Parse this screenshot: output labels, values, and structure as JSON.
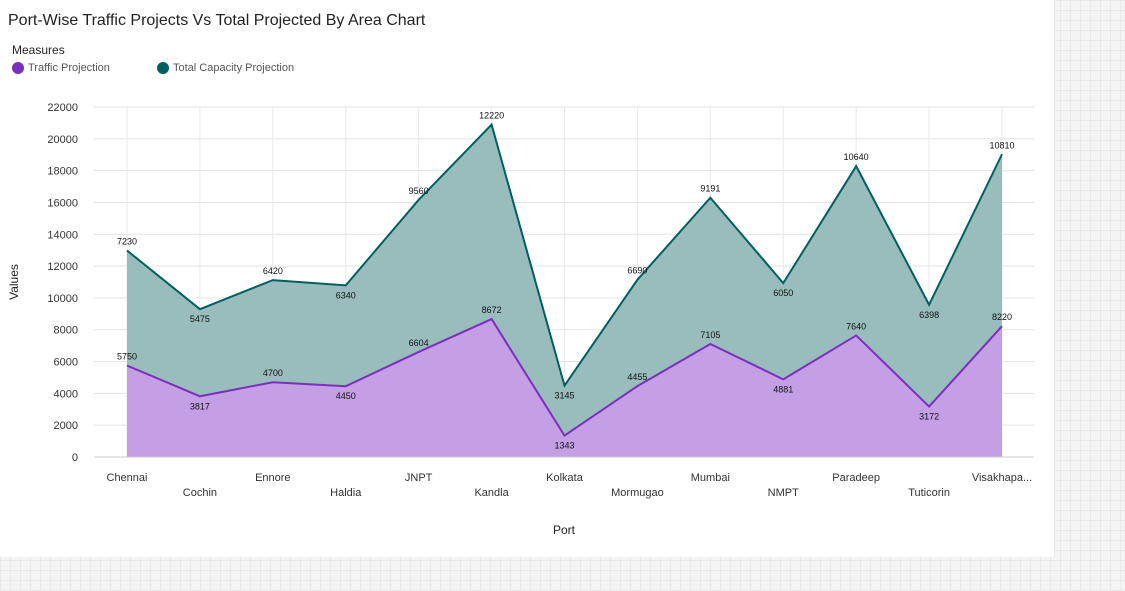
{
  "title": "Port-Wise Traffic Projects Vs Total Projected By Area Chart",
  "legend": {
    "title": "Measures",
    "items": [
      {
        "label": "Traffic Projection",
        "color": "#7B2FBE"
      },
      {
        "label": "Total Capacity Projection",
        "color": "#005F5F"
      }
    ]
  },
  "chart_data": {
    "type": "area",
    "stacked": true,
    "xlabel": "Port",
    "ylabel": "Values",
    "ylim": [
      0,
      22000
    ],
    "yticks": [
      0,
      2000,
      4000,
      6000,
      8000,
      10000,
      12000,
      14000,
      16000,
      18000,
      20000,
      22000
    ],
    "grid": true,
    "legend_position": "top-left",
    "categories": [
      "Chennai",
      "Cochin",
      "Ennore",
      "Haldia",
      "JNPT",
      "Kandla",
      "Kolkata",
      "Mormugao",
      "Mumbai",
      "NMPT",
      "Paradeep",
      "Tuticorin",
      "Visakhapa..."
    ],
    "series": [
      {
        "name": "Traffic Projection",
        "color": "#7B2FBE",
        "fill": "#C49FE5",
        "values": [
          5750,
          3817,
          4700,
          4450,
          6604,
          8672,
          1343,
          4455,
          7105,
          4881,
          7640,
          3172,
          8220
        ]
      },
      {
        "name": "Total Capacity Projection",
        "color": "#005F5F",
        "fill": "#99BDBD",
        "values": [
          7230,
          5475,
          6420,
          6340,
          9560,
          12220,
          3145,
          6690,
          9191,
          6050,
          10640,
          6398,
          10810
        ]
      }
    ]
  }
}
